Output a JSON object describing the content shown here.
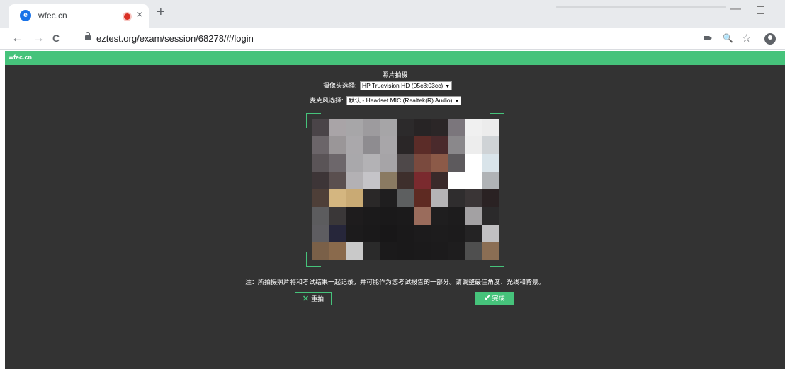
{
  "browser": {
    "tab": {
      "favicon": "chat-bubble-icon",
      "title": "wfec.cn",
      "recording": "recording-dot-icon",
      "close": "×"
    },
    "new_tab": "+",
    "window_controls": {
      "minimize": "—",
      "restore": "restore-icon"
    },
    "nav": {
      "back": "←",
      "forward": "→",
      "reload": "C"
    },
    "url": "eztest.org/exam/session/68278/#/login",
    "toolbar_icons": {
      "camera": "camera-icon",
      "zoom": "🔍",
      "bookmark": "☆",
      "profile": "profile-icon"
    }
  },
  "page": {
    "brand": "wfec.cn",
    "brand_color": "#46c37b",
    "background": "#333333",
    "title": "照片拍摄",
    "camera_label": "摄像头选择:",
    "camera_value": "HP Truevision HD (05c8:03cc)",
    "mic_label": "麦克风选择:",
    "mic_value": "默认 - Headset MIC (Realtek(R) Audio)",
    "note": "注：所拍摄照片将和考试结果一起记录，并可能作为您考试报告的一部分。请调整最佳角度、光线和背景。",
    "retake_label": "重拍",
    "done_label": "完成"
  },
  "preview_mosaic": [
    [
      "#4a4448",
      "#a9a4a7",
      "#a7a6a8",
      "#9d9b9e",
      "#a6a5a7",
      "#2c2a2b",
      "#272425",
      "#2b2627",
      "#7b767c",
      "#f0f0f0",
      "#ececec"
    ],
    [
      "#6b6569",
      "#9a9698",
      "#aaa8ab",
      "#8e8c90",
      "#a8a6a9",
      "#2a2627",
      "#5b2c28",
      "#4a2a2c",
      "#8a888b",
      "#ededed",
      "#cfd3d6"
    ],
    [
      "#5a5457",
      "#6d676b",
      "#a9a8ab",
      "#b3b2b5",
      "#a6a4a7",
      "#4e4849",
      "#7a4a3e",
      "#8c5a48",
      "#5d5a5d",
      "#ffffff",
      "#d9e4ea"
    ],
    [
      "#3d3537",
      "#5a4f4f",
      "#b3b1b4",
      "#c5c4c8",
      "#8a7a62",
      "#3e2f2c",
      "#7a2a2e",
      "#3a2a2a",
      "#ffffff",
      "#ffffff",
      "#b0b3b6"
    ],
    [
      "#4e3f38",
      "#d4b680",
      "#c9aa74",
      "#2a2828",
      "#1f1e1f",
      "#5d5f60",
      "#5e2a22",
      "#b5b4b6",
      "#2f2d2e",
      "#3a3536",
      "#2a2223"
    ],
    [
      "#5c5c5e",
      "#3a3738",
      "#1e1c1d",
      "#1b1a1b",
      "#1a191a",
      "#1b1a1b",
      "#9a6c5c",
      "#1f1e1f",
      "#1d1c1d",
      "#a3a1a3",
      "#2b2a2b"
    ],
    [
      "#5e5d61",
      "#26263a",
      "#1c1b1c",
      "#1a191a",
      "#181718",
      "#1a191a",
      "#1c1b1c",
      "#1d1c1d",
      "#1c1b1c",
      "#242324",
      "#c1c0c2"
    ],
    [
      "#7a6048",
      "#8a6a4c",
      "#c9c9c9",
      "#2a2a2a",
      "#1b1a1b",
      "#1a191a",
      "#1b1a1b",
      "#1c1b1c",
      "#1e1d1e",
      "#4f4f4f",
      "#8b6e54"
    ]
  ]
}
